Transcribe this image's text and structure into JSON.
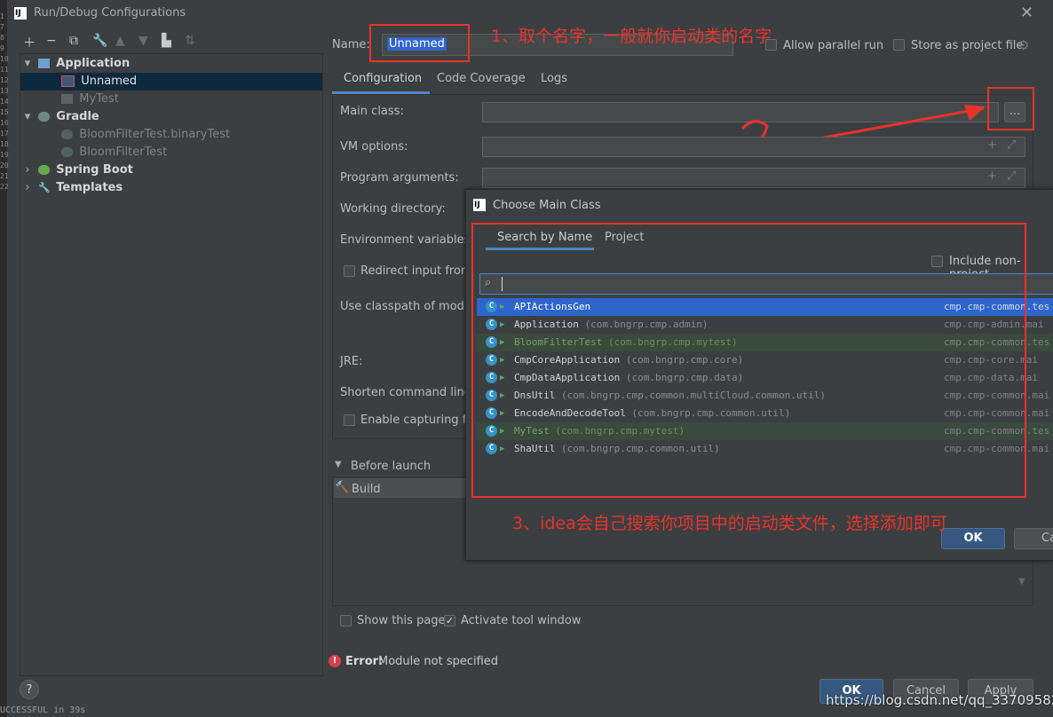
{
  "window": {
    "title": "Run/Debug Configurations"
  },
  "edge_digits": [
    "1",
    "7",
    "8",
    "9",
    "10",
    "11",
    "12",
    "13",
    "14",
    "15",
    "16",
    "17",
    "18",
    "19",
    "20",
    "21",
    "22"
  ],
  "tree": {
    "application": "Application",
    "unnamed": "Unnamed",
    "mytest": "MyTest",
    "gradle": "Gradle",
    "bloom_binary": "BloomFilterTest.binaryTest",
    "bloom": "BloomFilterTest",
    "spring_boot": "Spring Boot",
    "templates": "Templates"
  },
  "form": {
    "name_label": "Name:",
    "name_value": "Unnamed",
    "allow_parallel": "Allow parallel run",
    "store_project": "Store as project file",
    "tabs": [
      "Configuration",
      "Code Coverage",
      "Logs"
    ],
    "main_class": "Main class:",
    "browse": "...",
    "vm_options": "VM options:",
    "program_args": "Program arguments:",
    "working_dir": "Working directory:",
    "env_vars": "Environment variables:",
    "redirect": "Redirect input from:",
    "classpath": "Use classpath of module",
    "jre": "JRE:",
    "shorten": "Shorten command line:",
    "capturing": "Enable capturing for",
    "before_launch": "Before launch",
    "build": "Build",
    "show_page": "Show this page",
    "activate_tool": "Activate tool window",
    "error_label": "Error:",
    "error_text": "Module not specified"
  },
  "annotations": {
    "step1": "1、取个名字，一般就你启动类的名字",
    "step2": "2",
    "step3": "3、idea会自己搜索你项目中的启动类文件，选择添加即可"
  },
  "dialog": {
    "title": "Choose Main Class",
    "tabs": [
      "Search by Name",
      "Project"
    ],
    "include_non_project": "Include non-project",
    "classes": [
      {
        "name": "APIActionsGen",
        "pkg": "",
        "module": "cmp.cmp-common.tes",
        "selected": true
      },
      {
        "name": "Application",
        "pkg": "(com.bngrp.cmp.admin)",
        "module": "cmp.cmp-admin.mai"
      },
      {
        "name": "BloomFilterTest",
        "pkg": "(com.bngrp.cmp.mytest)",
        "module": "cmp.cmp-common.tes",
        "test": true
      },
      {
        "name": "CmpCoreApplication",
        "pkg": "(com.bngrp.cmp.core)",
        "module": "cmp.cmp-core.mai"
      },
      {
        "name": "CmpDataApplication",
        "pkg": "(com.bngrp.cmp.data)",
        "module": "cmp.cmp-data.mai"
      },
      {
        "name": "DnsUtil",
        "pkg": "(com.bngrp.cmp.common.multiCloud.common.util)",
        "module": "cmp.cmp-common.mai"
      },
      {
        "name": "EncodeAndDecodeTool",
        "pkg": "(com.bngrp.cmp.common.util)",
        "module": "cmp.cmp-common.mai"
      },
      {
        "name": "MyTest",
        "pkg": "(com.bngrp.cmp.mytest)",
        "module": "cmp.cmp-common.tes",
        "test": true
      },
      {
        "name": "ShaUtil",
        "pkg": "(com.bngrp.cmp.common.util)",
        "module": "cmp.cmp-common.mai"
      }
    ],
    "ok": "OK",
    "cancel": "Canc"
  },
  "footer": {
    "help": "?",
    "ok": "OK",
    "cancel": "Cancel",
    "apply": "Apply",
    "watermark": "https://blog.csdn.net/qq_33709582",
    "console_text": "UCCESSFUL in 39s"
  },
  "colors": {
    "accent": "#4a88c7",
    "selection": "#0d293e",
    "error": "#e8332b",
    "annotation_red": "#e8332b"
  }
}
